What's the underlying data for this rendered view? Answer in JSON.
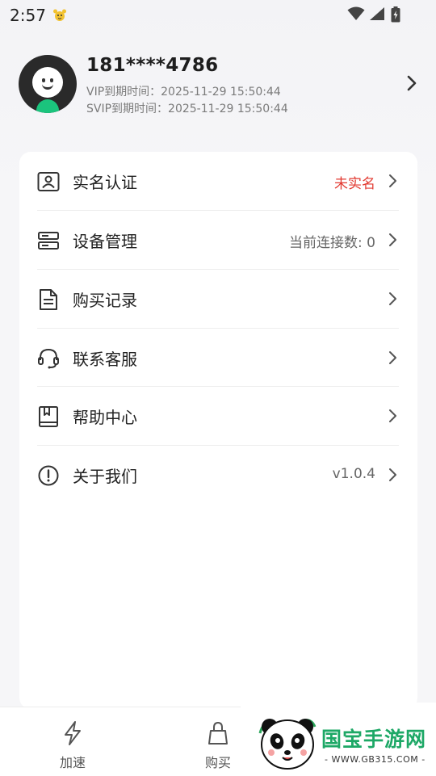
{
  "status_bar": {
    "time": "2:57"
  },
  "profile": {
    "phone": "181****4786",
    "vip_expiry": "VIP到期时间：2025-11-29 15:50:44",
    "svip_expiry": "SVIP到期时间：2025-11-29 15:50:44"
  },
  "menu": {
    "items": [
      {
        "label": "实名认证",
        "value": "未实名",
        "icon": "id-card-icon"
      },
      {
        "label": "设备管理",
        "value": "当前连接数: 0",
        "icon": "device-icon"
      },
      {
        "label": "购买记录",
        "value": "",
        "icon": "document-icon"
      },
      {
        "label": "联系客服",
        "value": "",
        "icon": "headset-icon"
      },
      {
        "label": "帮助中心",
        "value": "",
        "icon": "book-icon"
      },
      {
        "label": "关于我们",
        "value": "v1.0.4",
        "icon": "info-icon"
      }
    ]
  },
  "bottom_nav": {
    "items": [
      {
        "label": "加速",
        "icon": "lightning-icon"
      },
      {
        "label": "购买",
        "icon": "shopping-bag-icon"
      }
    ]
  },
  "watermark": {
    "text": "国宝手游网",
    "url": "- WWW.GB315.COM -"
  },
  "colors": {
    "accent_red": "#e23b32",
    "avatar_green": "#1bc47d",
    "watermark_green": "#1da866"
  }
}
